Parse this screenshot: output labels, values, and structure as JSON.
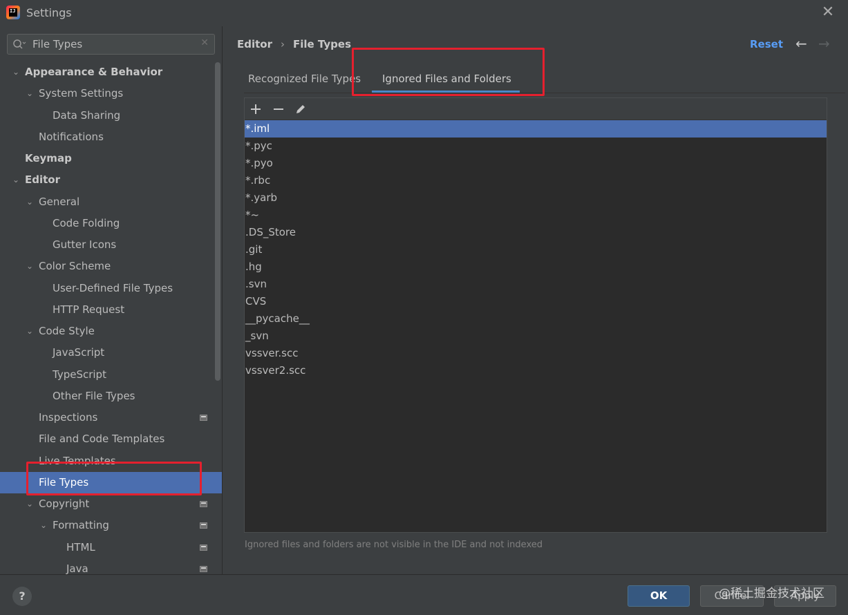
{
  "window": {
    "title": "Settings"
  },
  "search": {
    "value": "File Types",
    "placeholder": ""
  },
  "tree": [
    {
      "label": "Appearance & Behavior",
      "level": 0,
      "expandable": true,
      "expanded": true,
      "bold": true
    },
    {
      "label": "System Settings",
      "level": 1,
      "expandable": true,
      "expanded": true
    },
    {
      "label": "Data Sharing",
      "level": 2
    },
    {
      "label": "Notifications",
      "level": 1
    },
    {
      "label": "Keymap",
      "level": 0,
      "bold": true
    },
    {
      "label": "Editor",
      "level": 0,
      "expandable": true,
      "expanded": true,
      "bold": true
    },
    {
      "label": "General",
      "level": 1,
      "expandable": true,
      "expanded": true
    },
    {
      "label": "Code Folding",
      "level": 2
    },
    {
      "label": "Gutter Icons",
      "level": 2
    },
    {
      "label": "Color Scheme",
      "level": 1,
      "expandable": true,
      "expanded": true
    },
    {
      "label": "User-Defined File Types",
      "level": 2
    },
    {
      "label": "HTTP Request",
      "level": 2
    },
    {
      "label": "Code Style",
      "level": 1,
      "expandable": true,
      "expanded": true
    },
    {
      "label": "JavaScript",
      "level": 2
    },
    {
      "label": "TypeScript",
      "level": 2
    },
    {
      "label": "Other File Types",
      "level": 2
    },
    {
      "label": "Inspections",
      "level": 1,
      "project": true
    },
    {
      "label": "File and Code Templates",
      "level": 1
    },
    {
      "label": "Live Templates",
      "level": 1
    },
    {
      "label": "File Types",
      "level": 1,
      "selected": true
    },
    {
      "label": "Copyright",
      "level": 1,
      "expandable": true,
      "expanded": true,
      "project": true
    },
    {
      "label": "Formatting",
      "level": 2,
      "expandable": true,
      "expanded": true,
      "project": true
    },
    {
      "label": "HTML",
      "level": 3,
      "project": true
    },
    {
      "label": "Java",
      "level": 3,
      "project": true
    }
  ],
  "breadcrumb": {
    "parent": "Editor",
    "separator": "›",
    "current": "File Types"
  },
  "header_actions": {
    "reset": "Reset",
    "back_icon": "arrow-left-icon",
    "forward_icon": "arrow-right-icon"
  },
  "tabs": [
    {
      "label": "Recognized File Types",
      "active": false
    },
    {
      "label": "Ignored Files and Folders",
      "active": true
    }
  ],
  "toolbar": {
    "add_icon": "plus-icon",
    "remove_icon": "minus-icon",
    "edit_icon": "pencil-icon"
  },
  "ignored_items": [
    "*.iml",
    "*.pyc",
    "*.pyo",
    "*.rbc",
    "*.yarb",
    "*~",
    ".DS_Store",
    ".git",
    ".hg",
    ".svn",
    "CVS",
    "__pycache__",
    "_svn",
    "vssver.scc",
    "vssver2.scc"
  ],
  "selected_item": "*.iml",
  "hint": "Ignored files and folders are not visible in the IDE and not indexed",
  "footer": {
    "help": "?",
    "ok": "OK",
    "cancel": "Cancel",
    "apply": "Apply"
  },
  "watermark": "@稀土掘金技术社区",
  "colors": {
    "accent": "#4b6eaf",
    "link": "#589df6",
    "highlight": "#e5202e",
    "tab_underline": "#4a88c7"
  }
}
